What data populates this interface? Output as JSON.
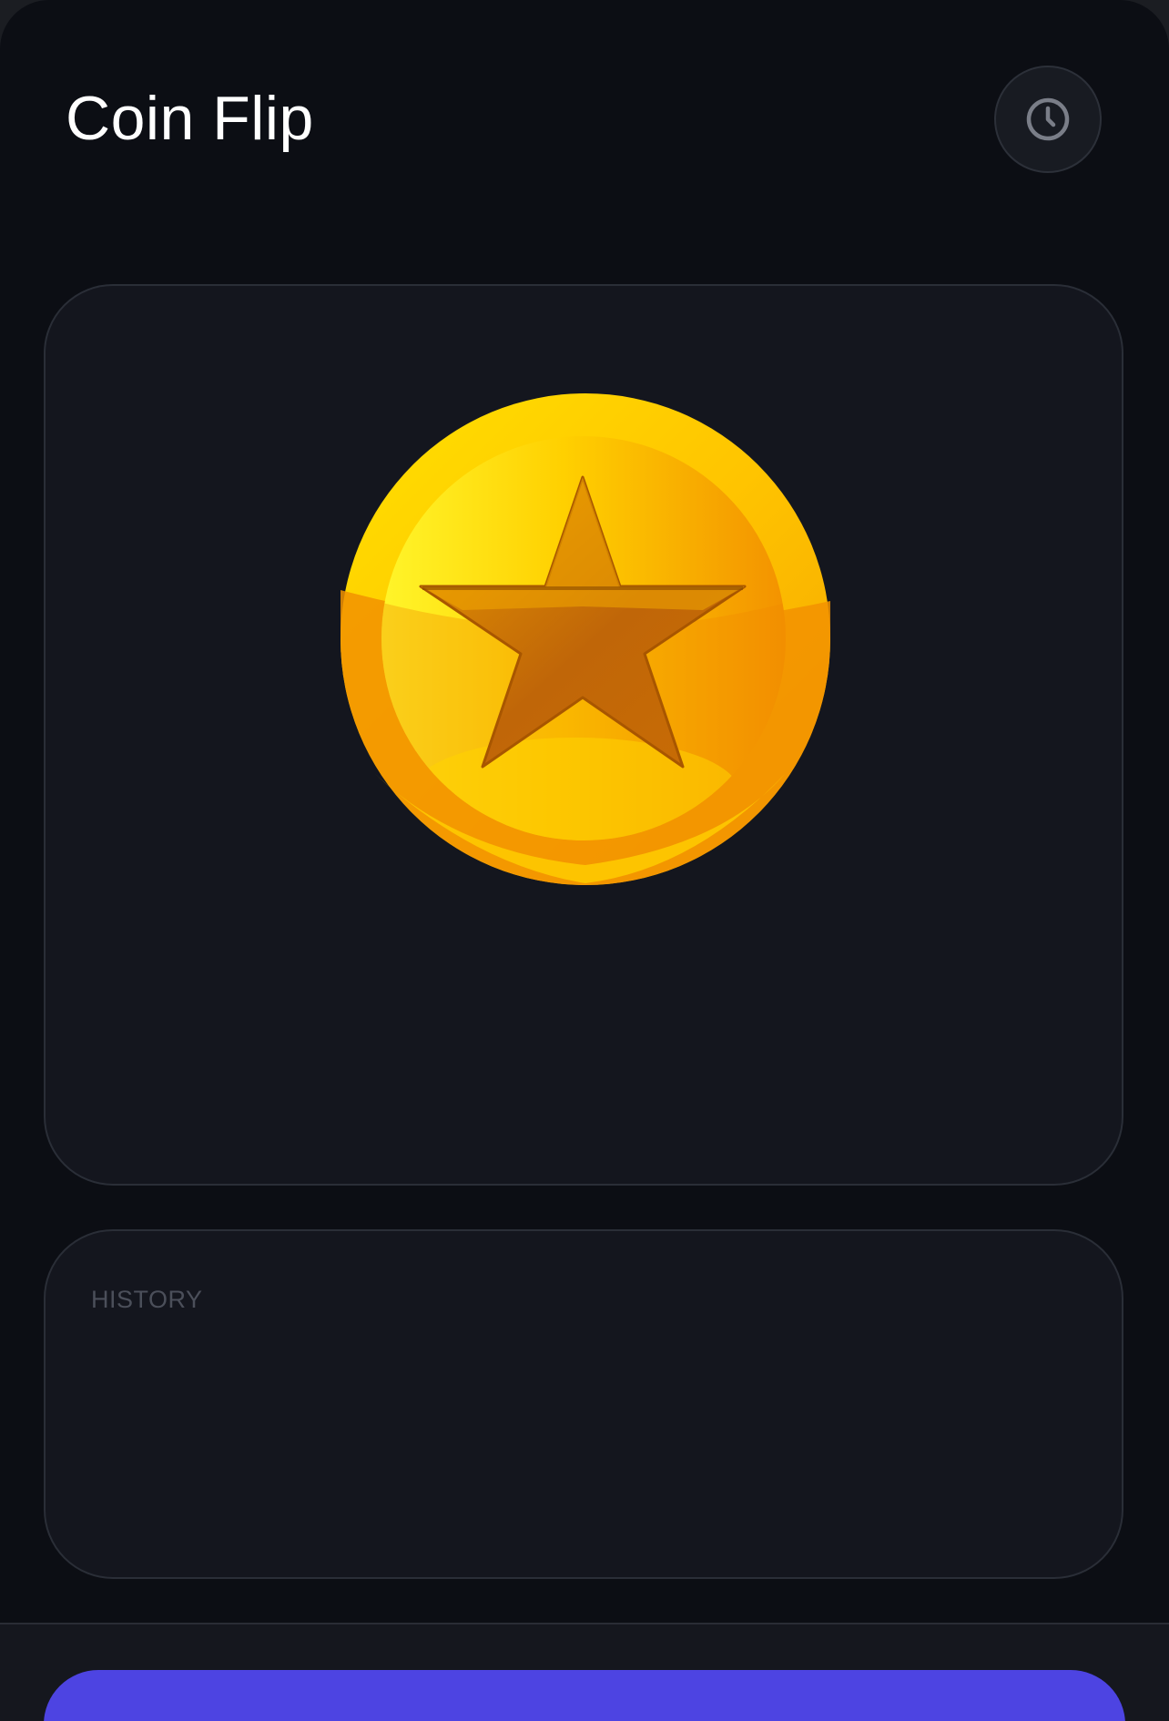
{
  "app": {
    "title": "Coin Flip"
  },
  "header": {
    "history_icon": "clock-icon"
  },
  "coin": {
    "face": "star",
    "icon": "star-coin-icon"
  },
  "history": {
    "heading": "HISTORY",
    "items": []
  },
  "footer": {
    "flip_label": ""
  },
  "colors": {
    "background": "#0c0e14",
    "card": "#14161e",
    "card_border": "#2a2e37",
    "accent": "#4d44e2",
    "coin_gold": "#ffd400",
    "coin_orange": "#f08a00",
    "star_brown": "#c0650a"
  }
}
